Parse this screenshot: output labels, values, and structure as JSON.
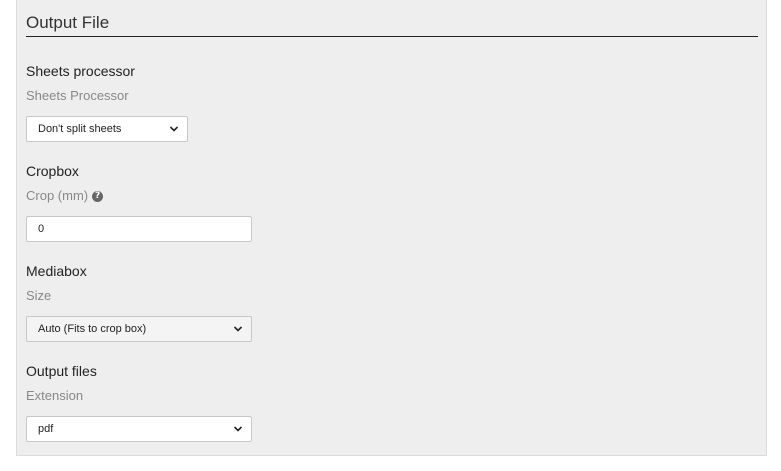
{
  "panel": {
    "title": "Output File"
  },
  "sheets_processor": {
    "heading": "Sheets processor",
    "label": "Sheets Processor",
    "value": "Don't split sheets"
  },
  "cropbox": {
    "heading": "Cropbox",
    "label": "Crop (mm)",
    "help_icon": "question-circle-icon",
    "value": "0"
  },
  "mediabox": {
    "heading": "Mediabox",
    "label": "Size",
    "value": "Auto (Fits to crop box)"
  },
  "output_files": {
    "heading": "Output files",
    "label": "Extension",
    "value": "pdf"
  }
}
